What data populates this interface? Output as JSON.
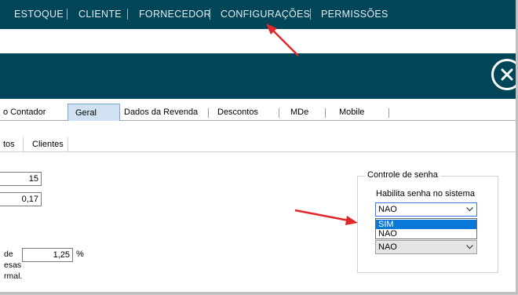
{
  "nav": {
    "items": [
      "ESTOQUE",
      "CLIENTE",
      "FORNECEDOR",
      "CONFIGURAÇÕES",
      "PERMISSÕES"
    ]
  },
  "tabs": [
    "o Contador",
    "Geral",
    "Dados da Revenda",
    "Descontos",
    "MDe",
    "Mobile"
  ],
  "active_tab": "Geral",
  "subtabs": [
    "tos",
    "Clientes"
  ],
  "fields": {
    "value_1": "15",
    "value_2": "0,17",
    "percent_value": "1,25",
    "percent_unit": "%",
    "label_lines": [
      "de",
      "esas",
      "rmal."
    ]
  },
  "password_group": {
    "title": "Controle de senha",
    "label": "Habilita senha no sistema",
    "selected": "NAO",
    "options": [
      "SIM",
      "NAO"
    ],
    "highlighted_option": "SIM",
    "second_select_value": "NAO"
  },
  "colors": {
    "header_bg": "#014559",
    "arrow": "#e0272a",
    "highlight": "#0a78d6"
  },
  "icons": [
    "close-icon",
    "chevron-down-icon",
    "annotation-arrow"
  ]
}
